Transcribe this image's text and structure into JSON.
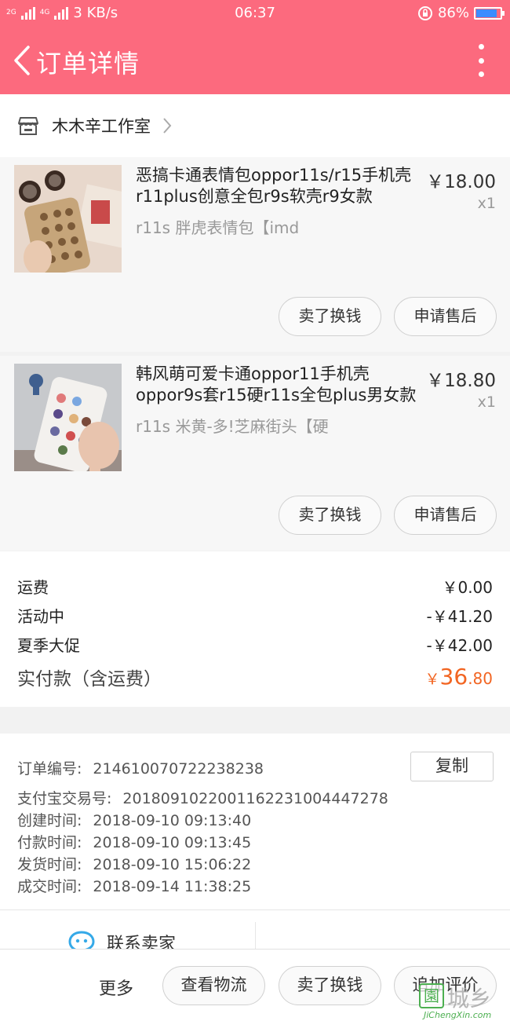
{
  "status_bar": {
    "signal_1": "2G",
    "signal_2": "4G",
    "net_speed": "3 KB/s",
    "time": "06:37",
    "battery": "86%",
    "battery_level": 0.86
  },
  "header": {
    "title": "订单详情"
  },
  "shop": {
    "name": "木木辛工作室"
  },
  "items": [
    {
      "name": "恶搞卡通表情包oppor11s/r15手机壳r11plus创意全包r9s软壳r9女款",
      "spec": "r11s 胖虎表情包【imd",
      "price": "￥18.00",
      "qty": "x1",
      "sell_label": "卖了换钱",
      "after_sale_label": "申请售后"
    },
    {
      "name": "韩风萌可爱卡通oppor11手机壳oppor9s套r15硬r11s全包plus男女款",
      "spec": "r11s 米黄-多!芝麻街头【硬",
      "price": "￥18.80",
      "qty": "x1",
      "sell_label": "卖了换钱",
      "after_sale_label": "申请售后"
    }
  ],
  "summary": {
    "shipping_label": "运费",
    "shipping_value": "￥0.00",
    "activity_label": "活动中",
    "activity_value": "-￥41.20",
    "promo_label": "夏季大促",
    "promo_value": "-￥42.00",
    "total_label": "实付款（含运费）",
    "total_currency": "￥",
    "total_int": "36",
    "total_dec": ".80"
  },
  "order_info": {
    "order_no_label": "订单编号:",
    "order_no": "2146100707222382​38",
    "copy_label": "复制",
    "alipay_label": "支付宝交易号:",
    "alipay_no": "2018091022001162231004447278",
    "created_label": "创建时间:",
    "created": "2018-09-10 09:13:40",
    "paid_label": "付款时间:",
    "paid": "2018-09-10 09:13:45",
    "shipped_label": "发货时间:",
    "shipped": "2018-09-10 15:06:22",
    "done_label": "成交时间:",
    "done": "2018-09-14 11:38:25",
    "contact_label": "联系卖家"
  },
  "bottom_bar": {
    "more_label": "更多",
    "logistics_label": "查看物流",
    "sell_label": "卖了换钱",
    "review_label": "追加评价"
  },
  "watermark": {
    "text": "城乡",
    "url": "JiChengXin.com"
  },
  "colors": {
    "accent": "#fc6a7e",
    "price_total": "#f26522"
  }
}
